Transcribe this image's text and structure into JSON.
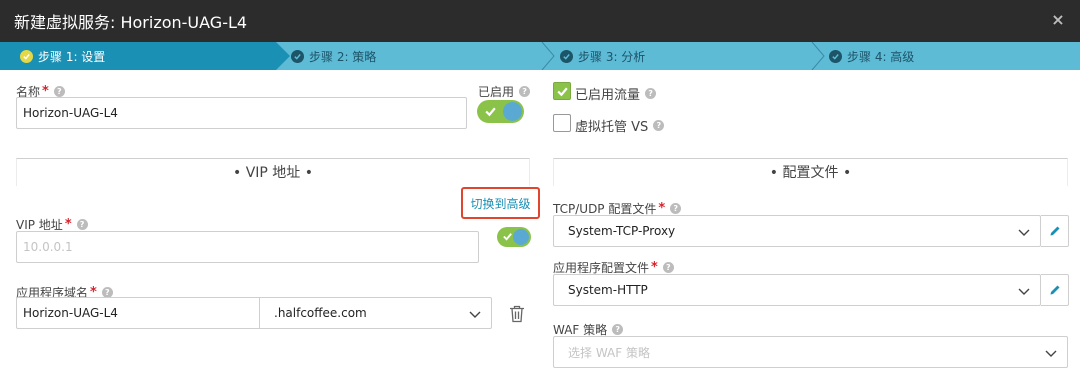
{
  "window": {
    "title": "新建虚拟服务: Horizon-UAG-L4",
    "close": "×"
  },
  "steps": [
    {
      "label": "步骤 1: 设置",
      "active": true
    },
    {
      "label": "步骤 2: 策略",
      "active": false
    },
    {
      "label": "步骤 3: 分析",
      "active": false
    },
    {
      "label": "步骤 4: 高级",
      "active": false
    }
  ],
  "form": {
    "name_label": "名称",
    "name_value": "Horizon-UAG-L4",
    "enabled_label": "已启用",
    "vip_section_title": "• VIP 地址 •",
    "switch_advanced": "切换到高级",
    "vip_label": "VIP 地址",
    "vip_placeholder": "10.0.0.1",
    "app_domain_label": "应用程序域名",
    "app_domain_value": "Horizon-UAG-L4",
    "domain_suffix": ".halfcoffee.com",
    "traffic_enabled_label": "已启用流量",
    "traffic_enabled": true,
    "virtual_hosted_label": "虚拟托管 VS",
    "virtual_hosted": false,
    "profile_section_title": "• 配置文件 •",
    "tcp_udp_label": "TCP/UDP 配置文件",
    "tcp_udp_value": "System-TCP-Proxy",
    "app_profile_label": "应用程序配置文件",
    "app_profile_value": "System-HTTP",
    "waf_label": "WAF 策略",
    "waf_placeholder": "选择 WAF 策略"
  },
  "colors": {
    "titlebar": "#2c2c2c",
    "step_active": "#1a90b5",
    "step_inactive": "#5ebbd6",
    "toggle_on": "#8bc34a",
    "required": "#d6232b",
    "highlight_box": "#e1452e"
  },
  "icons": {
    "help": "question-circle-icon",
    "check": "check-icon",
    "chevron": "chevron-down-icon",
    "edit": "pencil-icon",
    "delete": "trash-icon",
    "close": "close-icon"
  }
}
